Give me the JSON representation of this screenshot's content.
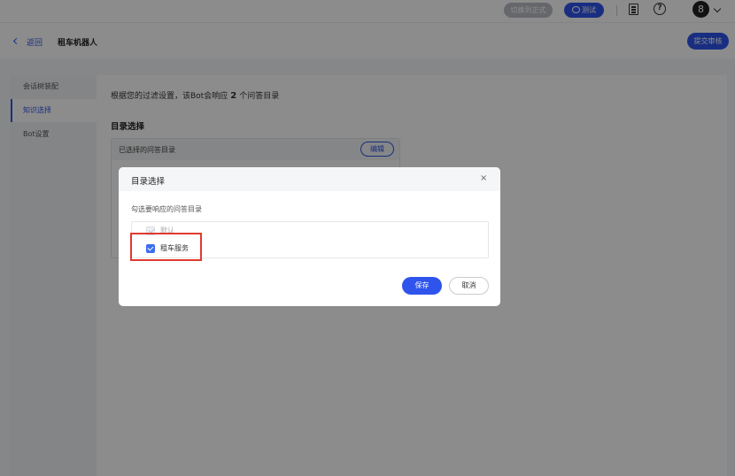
{
  "topbar": {
    "switch_label": "切换到正式",
    "test_label": "测试",
    "avatar_text": "8"
  },
  "header": {
    "back_label": "返回",
    "title": "租车机器人",
    "submit_label": "提交审核"
  },
  "sidebar": {
    "items": [
      {
        "label": "会话树装配"
      },
      {
        "label": "知识选择"
      },
      {
        "label": "Bot设置"
      }
    ]
  },
  "main": {
    "summary_prefix": "根据您的过滤设置，该Bot会响应",
    "summary_count": "2",
    "summary_suffix": "个问答目录",
    "section_title": "目录选择",
    "card_label": "已选择的问答目录",
    "edit_label": "编辑"
  },
  "modal": {
    "title": "目录选择",
    "close_glyph": "×",
    "instruction": "勾选要响应的问答目录",
    "options": [
      {
        "label": "默认",
        "checked": true,
        "disabled": true
      },
      {
        "label": "租车服务",
        "checked": true,
        "disabled": false
      }
    ],
    "save_label": "保存",
    "cancel_label": "取消"
  },
  "colors": {
    "accent": "#2f54eb",
    "highlight": "#e03a2f"
  }
}
